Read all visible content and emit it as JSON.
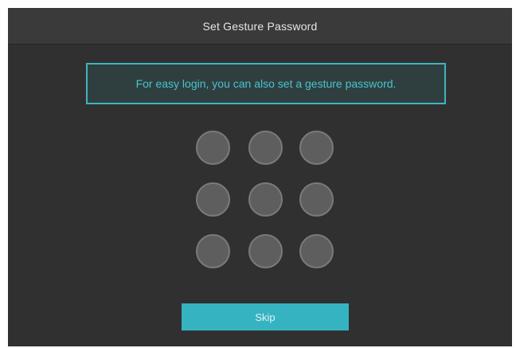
{
  "dialog": {
    "title": "Set Gesture Password",
    "hint": "For easy login, you can also set a gesture password.",
    "skip_label": "Skip"
  },
  "gesture_grid": {
    "rows": 3,
    "columns": 3
  },
  "colors": {
    "background": "#303030",
    "header": "#3a3a3a",
    "accent": "#3fb4bd",
    "accent_text": "#49c4cc",
    "dot_fill": "#5e5e5e",
    "dot_border": "#7a7a7a",
    "button": "#36b3c1"
  }
}
